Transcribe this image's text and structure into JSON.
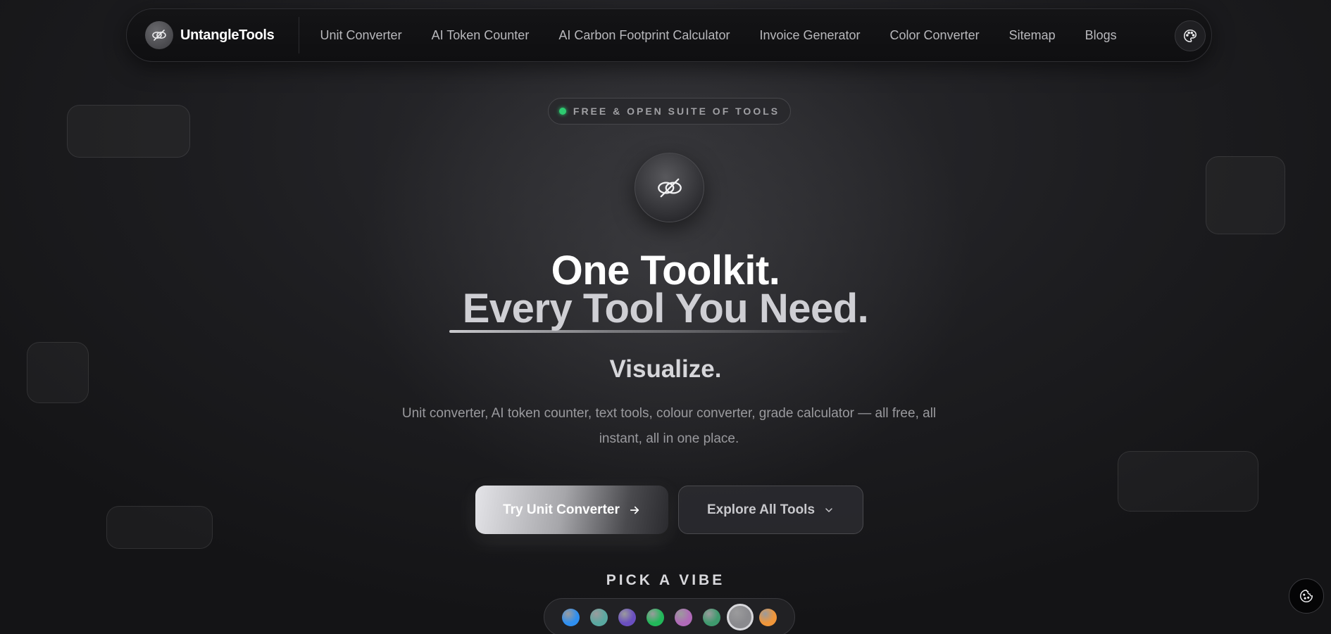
{
  "nav": {
    "brand": "UntangleTools",
    "links": [
      {
        "label": "Unit Converter"
      },
      {
        "label": "AI Token Counter"
      },
      {
        "label": "AI Carbon Footprint Calculator"
      },
      {
        "label": "Invoice Generator"
      },
      {
        "label": "Color Converter"
      },
      {
        "label": "Sitemap"
      },
      {
        "label": "Blogs"
      }
    ],
    "theme_icon": "palette-icon",
    "brand_icon": "untangle-logo-icon"
  },
  "hero": {
    "badge": "FREE & OPEN SUITE OF TOOLS",
    "badge_dot_color": "#2ecc71",
    "logo_icon": "untangle-logo-icon",
    "title_line1": "One Toolkit.",
    "title_line2": "Every Tool You Need.",
    "rotating_word": "Visualize.",
    "description": "Unit converter, AI token counter, text tools, colour converter, grade calculator — all free, all instant, all in one place."
  },
  "buttons": {
    "primary_label": "Try Unit Converter",
    "primary_icon": "arrow-right-icon",
    "secondary_label": "Explore All Tools",
    "secondary_icon": "chevron-down-icon"
  },
  "vibe": {
    "title": "PICK A VIBE",
    "swatches": [
      {
        "name": "blue",
        "color": "#2f8ff0"
      },
      {
        "name": "teal",
        "color": "#5aa8a0"
      },
      {
        "name": "purple",
        "color": "#6a4fc0"
      },
      {
        "name": "green",
        "color": "#22b85a"
      },
      {
        "name": "orchid",
        "color": "#b06ab8"
      },
      {
        "name": "emerald",
        "color": "#3f9a6e"
      },
      {
        "name": "silver",
        "color": "#8a8a8e",
        "selected": true
      },
      {
        "name": "orange",
        "color": "#f0963a"
      }
    ]
  },
  "cookie_icon": "cookie-icon"
}
